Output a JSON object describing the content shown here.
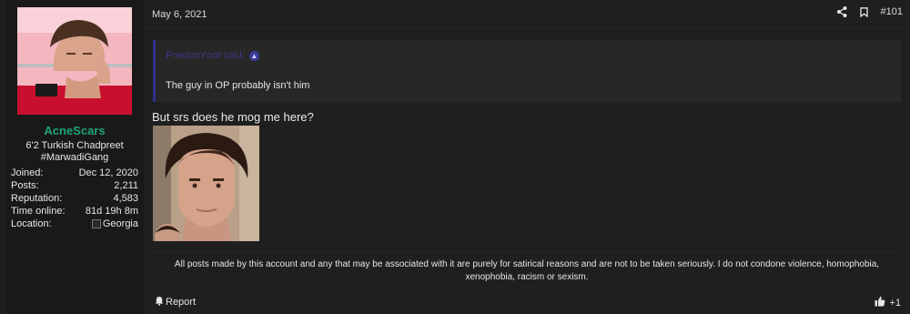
{
  "author": {
    "username": "AcneScars",
    "title_lines": [
      "6'2 Turkish Chadpreet",
      "#MarwadiGang"
    ],
    "stats": [
      {
        "label": "Joined:",
        "value": "Dec 12, 2020"
      },
      {
        "label": "Posts:",
        "value": "2,211"
      },
      {
        "label": "Reputation:",
        "value": "4,583"
      },
      {
        "label": "Time online:",
        "value": "81d 19h 8m"
      },
      {
        "label": "Location:",
        "value": "Georgia"
      }
    ],
    "accent": "#1fa37a"
  },
  "post": {
    "date": "May 6, 2021",
    "number": "#101",
    "quote": {
      "author_said": "PrestonYnot said:",
      "text": "The guy in OP probably isn't him"
    },
    "message": "But srs does he mog me here?",
    "signature": "All posts made by this account and any that may be associated with it are purely for satirical reasons and are not to be taken seriously. I do not condone violence, homophobia, xenophobia, racism or sexism.",
    "report_label": "Report",
    "reaction_count": "+1"
  },
  "icons": {
    "share": "share-icon",
    "bookmark": "bookmark-icon",
    "quote_jump": "arrow-up-circle-icon",
    "report": "bell-icon",
    "like": "thumbs-up-icon"
  }
}
